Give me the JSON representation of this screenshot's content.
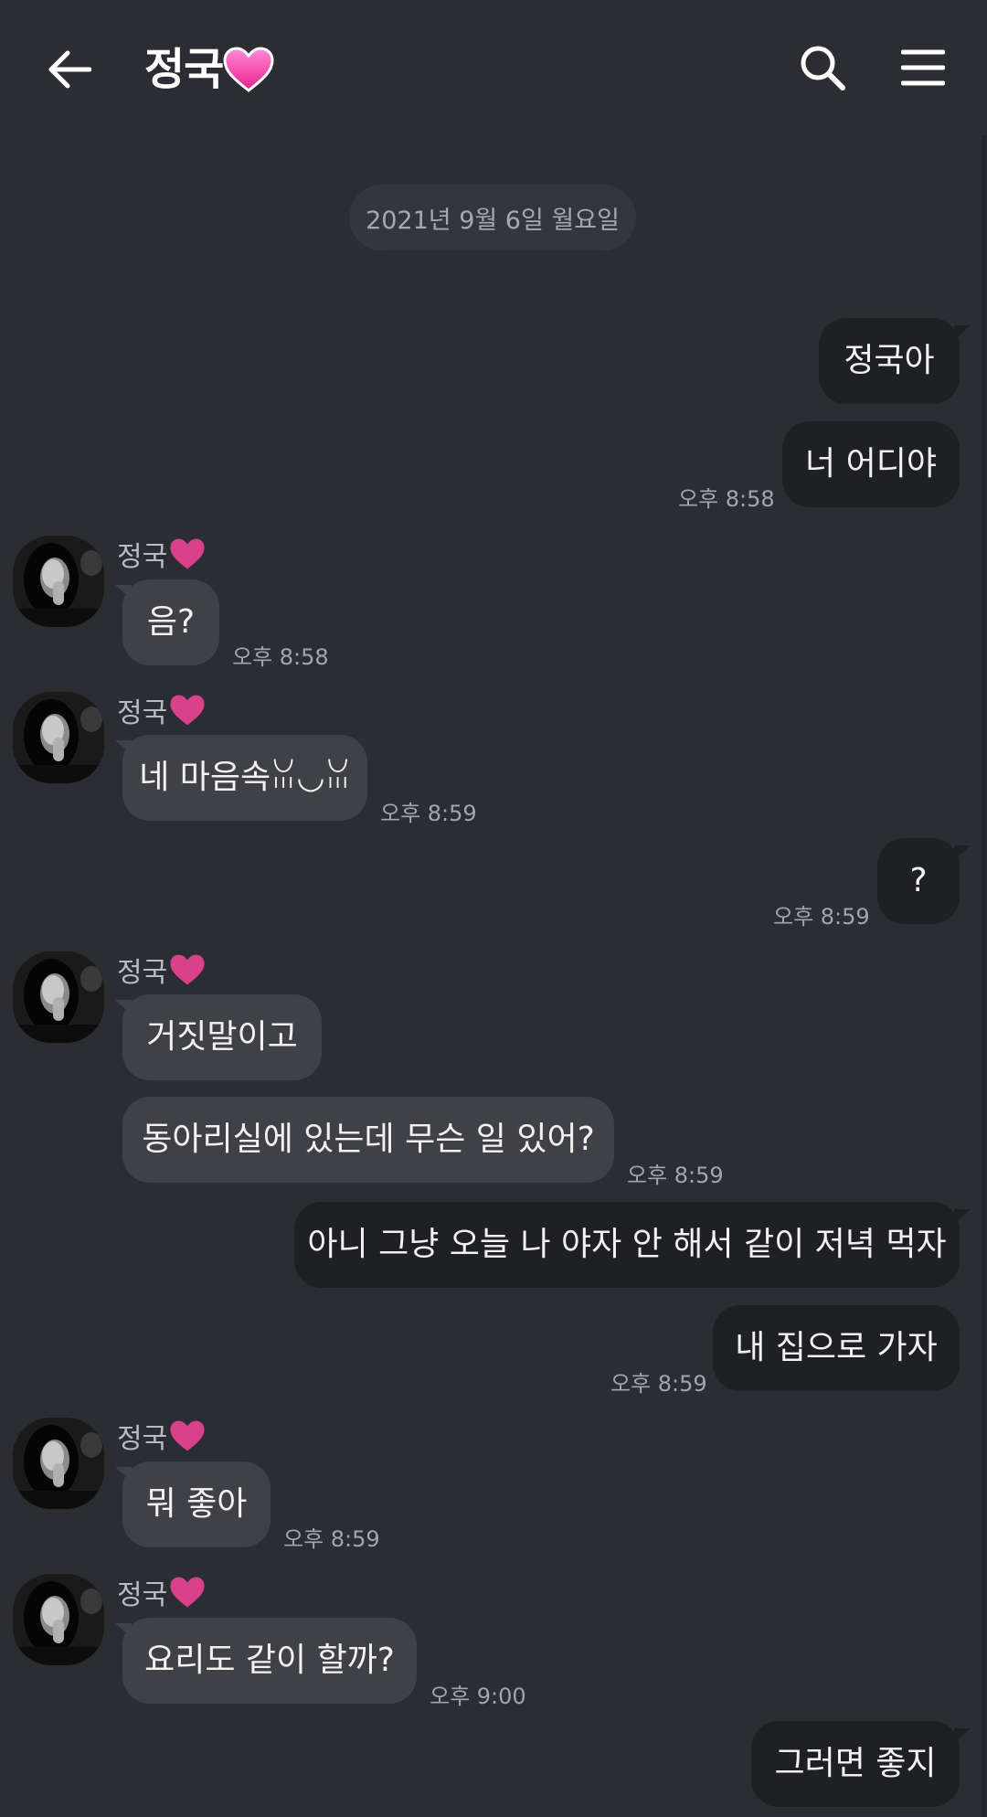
{
  "header": {
    "title": "정국",
    "back_icon": "arrow-left-icon",
    "search_icon": "search-icon",
    "menu_icon": "hamburger-menu-icon"
  },
  "date_divider": "2021년 9월 6일 월요일",
  "sender_name": "정국",
  "colors": {
    "background": "#2b2d33",
    "my_bubble": "#1e2024",
    "their_bubble": "#3f4147",
    "heart": "#e0407a"
  },
  "messages": [
    {
      "side": "mine",
      "text": "정국아"
    },
    {
      "side": "mine",
      "text": "너 어디야",
      "time": "오후 8:58"
    },
    {
      "side": "theirs",
      "text": "음?",
      "time": "오후 8:58"
    },
    {
      "side": "theirs",
      "text": "네 마음속ꈍ◡ꈍ",
      "time": "오후 8:59"
    },
    {
      "side": "mine",
      "text": "?",
      "time": "오후 8:59"
    },
    {
      "side": "theirs",
      "text": "거짓말이고"
    },
    {
      "side": "theirs",
      "text": "동아리실에 있는데 무슨 일 있어?",
      "time": "오후 8:59"
    },
    {
      "side": "mine",
      "text": "아니 그냥 오늘 나 야자 안 해서 같이 저녁 먹자"
    },
    {
      "side": "mine",
      "text": "내 집으로 가자",
      "time": "오후 8:59"
    },
    {
      "side": "theirs",
      "text": "뭐 좋아",
      "time": "오후 8:59"
    },
    {
      "side": "theirs",
      "text": "요리도 같이 할까?",
      "time": "오후 9:00"
    },
    {
      "side": "mine",
      "text": "그러면 좋지"
    }
  ]
}
